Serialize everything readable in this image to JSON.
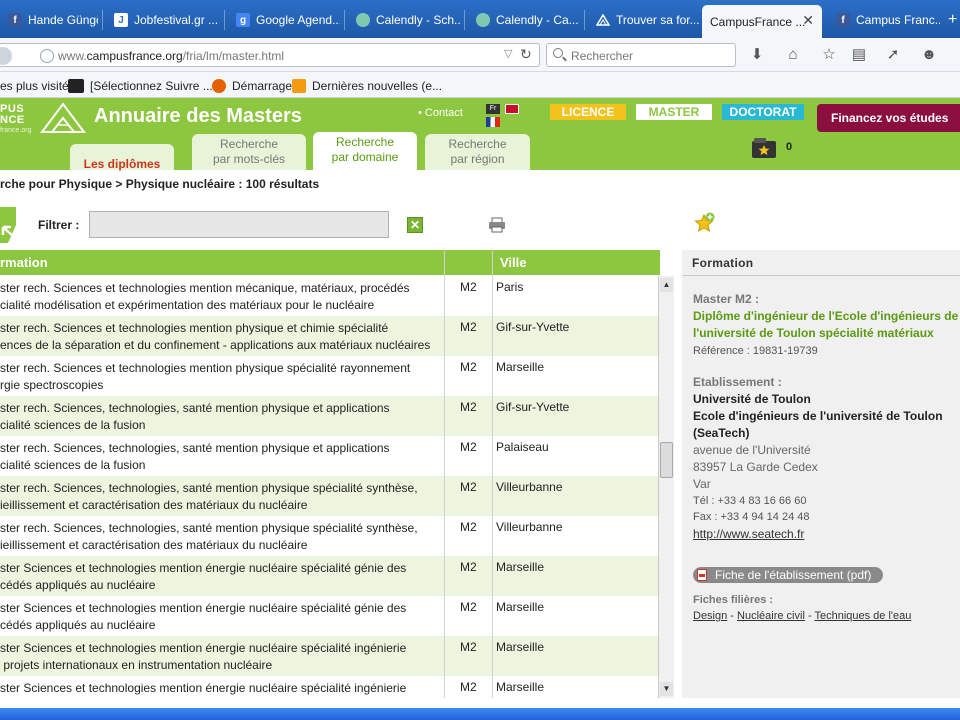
{
  "browser": {
    "tabs": [
      {
        "label": "Hande Güngör",
        "icon": "facebook-icon"
      },
      {
        "label": "Jobfestival.gr ...",
        "icon": "site-icon"
      },
      {
        "label": "Google Agend...",
        "icon": "google-icon"
      },
      {
        "label": "Calendly - Sch...",
        "icon": "calendly-icon"
      },
      {
        "label": "Calendly - Ca...",
        "icon": "calendly-icon"
      },
      {
        "label": "Trouver sa for...",
        "icon": "campusfrance-icon"
      },
      {
        "label": "CampusFrance ...",
        "icon": "campusfrance-icon",
        "active": true
      },
      {
        "label": "Campus Franc...",
        "icon": "facebook-icon"
      }
    ],
    "url_prefix": "www.",
    "url_domain": "campusfrance.org",
    "url_path": "/fria/lm/master.html",
    "search_placeholder": "Rechercher",
    "bookmarks": [
      "es plus visités",
      "[Sélectionnez Suivre ...",
      "Démarrage",
      "Dernières nouvelles (e..."
    ]
  },
  "header": {
    "logo_line1": "PUS",
    "logo_line2": "NCE",
    "logo_sub": "france.org",
    "title": "Annuaire des Masters",
    "contact": "• Contact",
    "flag_fr": "Fr",
    "levels": {
      "licence": "LICENCE",
      "master": "MASTER",
      "doctorat": "DOCTORAT"
    },
    "finance": "Financez vos études",
    "tabs": {
      "diplomes": "Les diplômes",
      "mots_l1": "Recherche",
      "mots_l2": "par mots-clés",
      "domaine_l1": "Recherche",
      "domaine_l2": "par domaine",
      "region_l1": "Recherche",
      "region_l2": "par région"
    },
    "cart_count": "0"
  },
  "breadcrumb": "rche pour Physique > Physique nucléaire : 100 résultats",
  "filter": {
    "label": "Filtrer :",
    "value": ""
  },
  "table": {
    "col_formation": "rmation",
    "col_ville": "Ville",
    "rows": [
      {
        "l1": "ster rech. Sciences et technologies mention mécanique, matériaux, procédés",
        "l2": "cialité modélisation et expérimentation des matériaux pour le nucléaire",
        "level": "M2",
        "city": "Paris"
      },
      {
        "l1": "ster rech. Sciences et technologies mention physique et chimie spécialité",
        "l2": "ences de la séparation et du confinement - applications aux matériaux nucléaires",
        "level": "M2",
        "city": "Gif-sur-Yvette"
      },
      {
        "l1": "ster rech. Sciences et technologies mention physique spécialité rayonnement",
        "l2": "rgie spectroscopies",
        "level": "M2",
        "city": "Marseille"
      },
      {
        "l1": "ster rech. Sciences, technologies, santé mention physique et applications",
        "l2": "cialité sciences de la fusion",
        "level": "M2",
        "city": "Gif-sur-Yvette"
      },
      {
        "l1": "ster rech. Sciences, technologies, santé mention physique et applications",
        "l2": "cialité sciences de la fusion",
        "level": "M2",
        "city": "Palaiseau"
      },
      {
        "l1": "ster rech. Sciences, technologies, santé mention physique spécialité synthèse,",
        "l2": "ieillissement et caractérisation des matériaux du nucléaire",
        "level": "M2",
        "city": "Villeurbanne"
      },
      {
        "l1": "ster rech. Sciences, technologies, santé mention physique spécialité synthèse,",
        "l2": "ieillissement et caractérisation des matériaux du nucléaire",
        "level": "M2",
        "city": "Villeurbanne"
      },
      {
        "l1": "ster Sciences et technologies mention énergie nucléaire spécialité génie des",
        "l2": "cédés appliqués au nucléaire",
        "level": "M2",
        "city": "Marseille"
      },
      {
        "l1": "ster Sciences et technologies mention énergie nucléaire spécialité génie des",
        "l2": "cédés appliqués au nucléaire",
        "level": "M2",
        "city": "Marseille"
      },
      {
        "l1": "ster Sciences et technologies mention énergie nucléaire spécialité ingénierie",
        "l2": " projets internationaux en instrumentation nucléaire",
        "level": "M2",
        "city": "Marseille"
      },
      {
        "l1": "ster Sciences et technologies mention énergie nucléaire spécialité ingénierie",
        "l2": "",
        "level": "M2",
        "city": "Marseille"
      }
    ]
  },
  "panel": {
    "title": "Formation",
    "master_label": "Master M2 :",
    "diploma_l1": "Diplôme d'ingénieur de l'Ecole d'ingénieurs de",
    "diploma_l2": "l'université de Toulon spécialité matériaux",
    "reference": "Référence : 19831-19739",
    "etab_label": "Etablissement :",
    "univ": "Université de Toulon",
    "school_l1": "Ecole d'ingénieurs de l'université de Toulon",
    "school_l2": "(SeaTech)",
    "addr1": "avenue de l'Université",
    "addr2": "83957 La Garde Cedex",
    "addr3": "Var",
    "tel": "Tél : +33 4 83 16 66 60",
    "fax": "Fax : +33 4 94 14 24 48",
    "website": "http://www.seatech.fr",
    "pdf_button": "Fiche de l'établissement (pdf)",
    "fiches_label": "Fiches filières :",
    "fiches": [
      "Design",
      "Nucléaire civil",
      "Techniques de l'eau"
    ],
    "fiches_sep": " - "
  },
  "colors": {
    "brand_green": "#8dc63f",
    "finance_maroon": "#8a0f3f",
    "licence_yellow": "#f3c21b",
    "doctorat_cyan": "#29b8d6"
  }
}
